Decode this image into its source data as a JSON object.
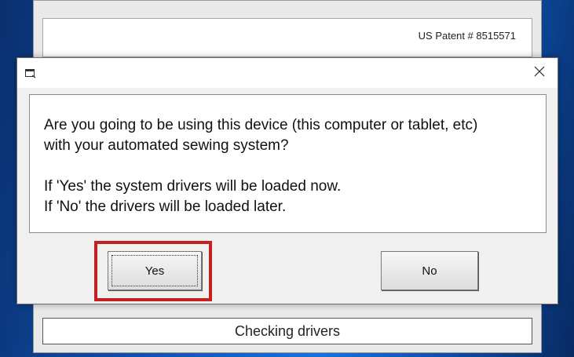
{
  "background_window": {
    "patent_text": "US Patent # 8515571",
    "status_text": "Checking drivers"
  },
  "dialog": {
    "title": "",
    "icon": "window-icon",
    "close_icon": "close-icon",
    "message_line1": "Are you going to be using this device (this computer or tablet, etc)",
    "message_line2": "with your automated sewing system?",
    "message_line3": "If 'Yes' the system drivers will be loaded now.",
    "message_line4": "If 'No' the drivers will be loaded later.",
    "yes_label": "Yes",
    "no_label": "No",
    "highlight_color": "#c3201f"
  }
}
